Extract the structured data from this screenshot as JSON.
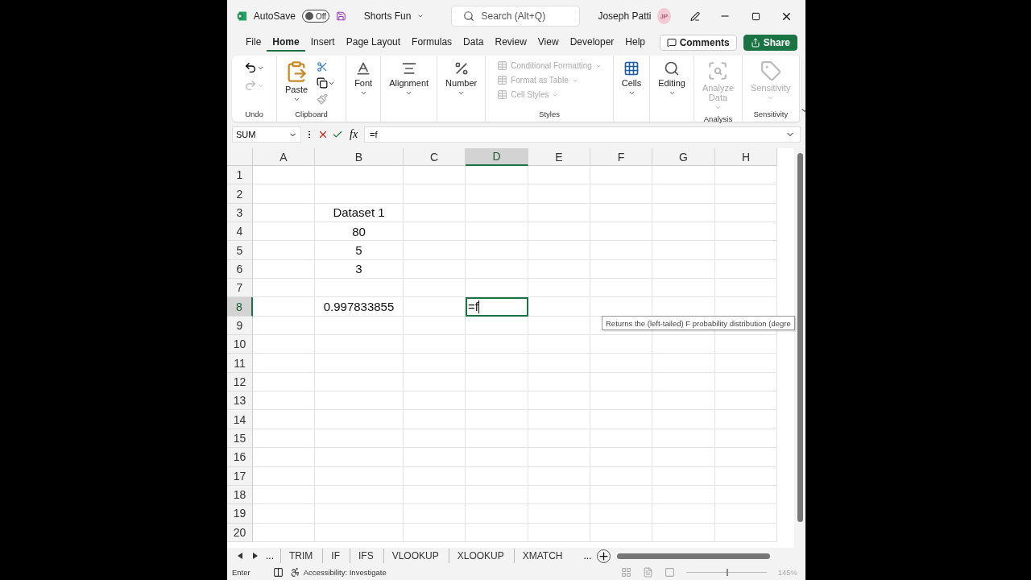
{
  "title_bar": {
    "autosave_label": "AutoSave",
    "autosave_on": false,
    "autosave_state": "Off",
    "file_name": "Shorts Fun",
    "search_placeholder": "Search (Alt+Q)",
    "user_name": "Joseph Patti",
    "user_initials": "JP"
  },
  "tabs": [
    {
      "label": "File",
      "selected": false
    },
    {
      "label": "Home",
      "selected": true
    },
    {
      "label": "Insert",
      "selected": false
    },
    {
      "label": "Page Layout",
      "selected": false
    },
    {
      "label": "Formulas",
      "selected": false
    },
    {
      "label": "Data",
      "selected": false
    },
    {
      "label": "Review",
      "selected": false
    },
    {
      "label": "View",
      "selected": false
    },
    {
      "label": "Developer",
      "selected": false
    },
    {
      "label": "Help",
      "selected": false
    }
  ],
  "comments_button": "Comments",
  "share_button": "Share",
  "ribbon": [
    {
      "label": "Undo",
      "kind": "undo"
    },
    {
      "label": "Clipboard",
      "kind": "clipboard",
      "items": [
        {
          "label": "Paste",
          "disabled": false
        }
      ]
    },
    {
      "kind": "font",
      "items": [
        {
          "label": "Font",
          "disabled": false
        }
      ]
    },
    {
      "kind": "alignment",
      "items": [
        {
          "label": "Alignment",
          "disabled": false
        }
      ]
    },
    {
      "kind": "number",
      "items": [
        {
          "label": "Number",
          "disabled": false
        }
      ]
    },
    {
      "label": "Styles",
      "kind": "styles",
      "items": [
        {
          "label": "Conditional Formatting",
          "disabled": true
        },
        {
          "label": "Format as Table",
          "disabled": true
        },
        {
          "label": "Cell Styles",
          "disabled": true
        }
      ]
    },
    {
      "kind": "cells",
      "items": [
        {
          "label": "Cells",
          "disabled": false
        }
      ]
    },
    {
      "kind": "editing",
      "items": [
        {
          "label": "Editing",
          "disabled": false
        }
      ]
    },
    {
      "label": "Analysis",
      "kind": "analysis",
      "items": [
        {
          "label": "Analyze Data",
          "disabled": true
        }
      ]
    },
    {
      "label": "Sensitivity",
      "kind": "sensitivity",
      "items": [
        {
          "label": "Sensitivity",
          "disabled": true
        }
      ]
    }
  ],
  "formula_bar": {
    "name_box": "SUM",
    "fx": "fx",
    "formula": "=f"
  },
  "columns": [
    {
      "label": "A",
      "selected": false
    },
    {
      "label": "B",
      "selected": false
    },
    {
      "label": "C",
      "selected": false
    },
    {
      "label": "D",
      "selected": true
    },
    {
      "label": "E",
      "selected": false
    },
    {
      "label": "F",
      "selected": false
    },
    {
      "label": "G",
      "selected": false
    },
    {
      "label": "H",
      "selected": false
    }
  ],
  "rows": [
    {
      "label": "1",
      "selected": false
    },
    {
      "label": "2",
      "selected": false
    },
    {
      "label": "3",
      "selected": false,
      "b": "Dataset 1"
    },
    {
      "label": "4",
      "selected": false,
      "b": "80"
    },
    {
      "label": "5",
      "selected": false,
      "b": "5"
    },
    {
      "label": "6",
      "selected": false,
      "b": "3"
    },
    {
      "label": "7",
      "selected": false
    },
    {
      "label": "8",
      "selected": true,
      "b": "0.997833855",
      "d": "=f"
    },
    {
      "label": "9",
      "selected": false
    },
    {
      "label": "10",
      "selected": false
    },
    {
      "label": "11",
      "selected": false
    },
    {
      "label": "12",
      "selected": false
    },
    {
      "label": "13",
      "selected": false
    },
    {
      "label": "14",
      "selected": false
    },
    {
      "label": "15",
      "selected": false
    },
    {
      "label": "16",
      "selected": false
    },
    {
      "label": "17",
      "selected": false
    },
    {
      "label": "18",
      "selected": false
    },
    {
      "label": "19",
      "selected": false
    },
    {
      "label": "20",
      "selected": false
    }
  ],
  "tooltip": "Returns the (left-tailed) F probability distribution (degre",
  "sheet_nav_more": "...",
  "sheet_tabs": [
    {
      "label": "TRIM",
      "selected": false
    },
    {
      "label": "IF",
      "selected": false
    },
    {
      "label": "IFS",
      "selected": false
    },
    {
      "label": "VLOOKUP",
      "selected": false
    },
    {
      "label": "XLOOKUP",
      "selected": false
    },
    {
      "label": "XMATCH",
      "selected": false
    }
  ],
  "sheet_more": "...",
  "status_bar": {
    "mode": "Enter",
    "accessibility": "Accessibility: Investigate",
    "zoom": "145%",
    "zoom_slider": {
      "level": 0.5
    }
  }
}
